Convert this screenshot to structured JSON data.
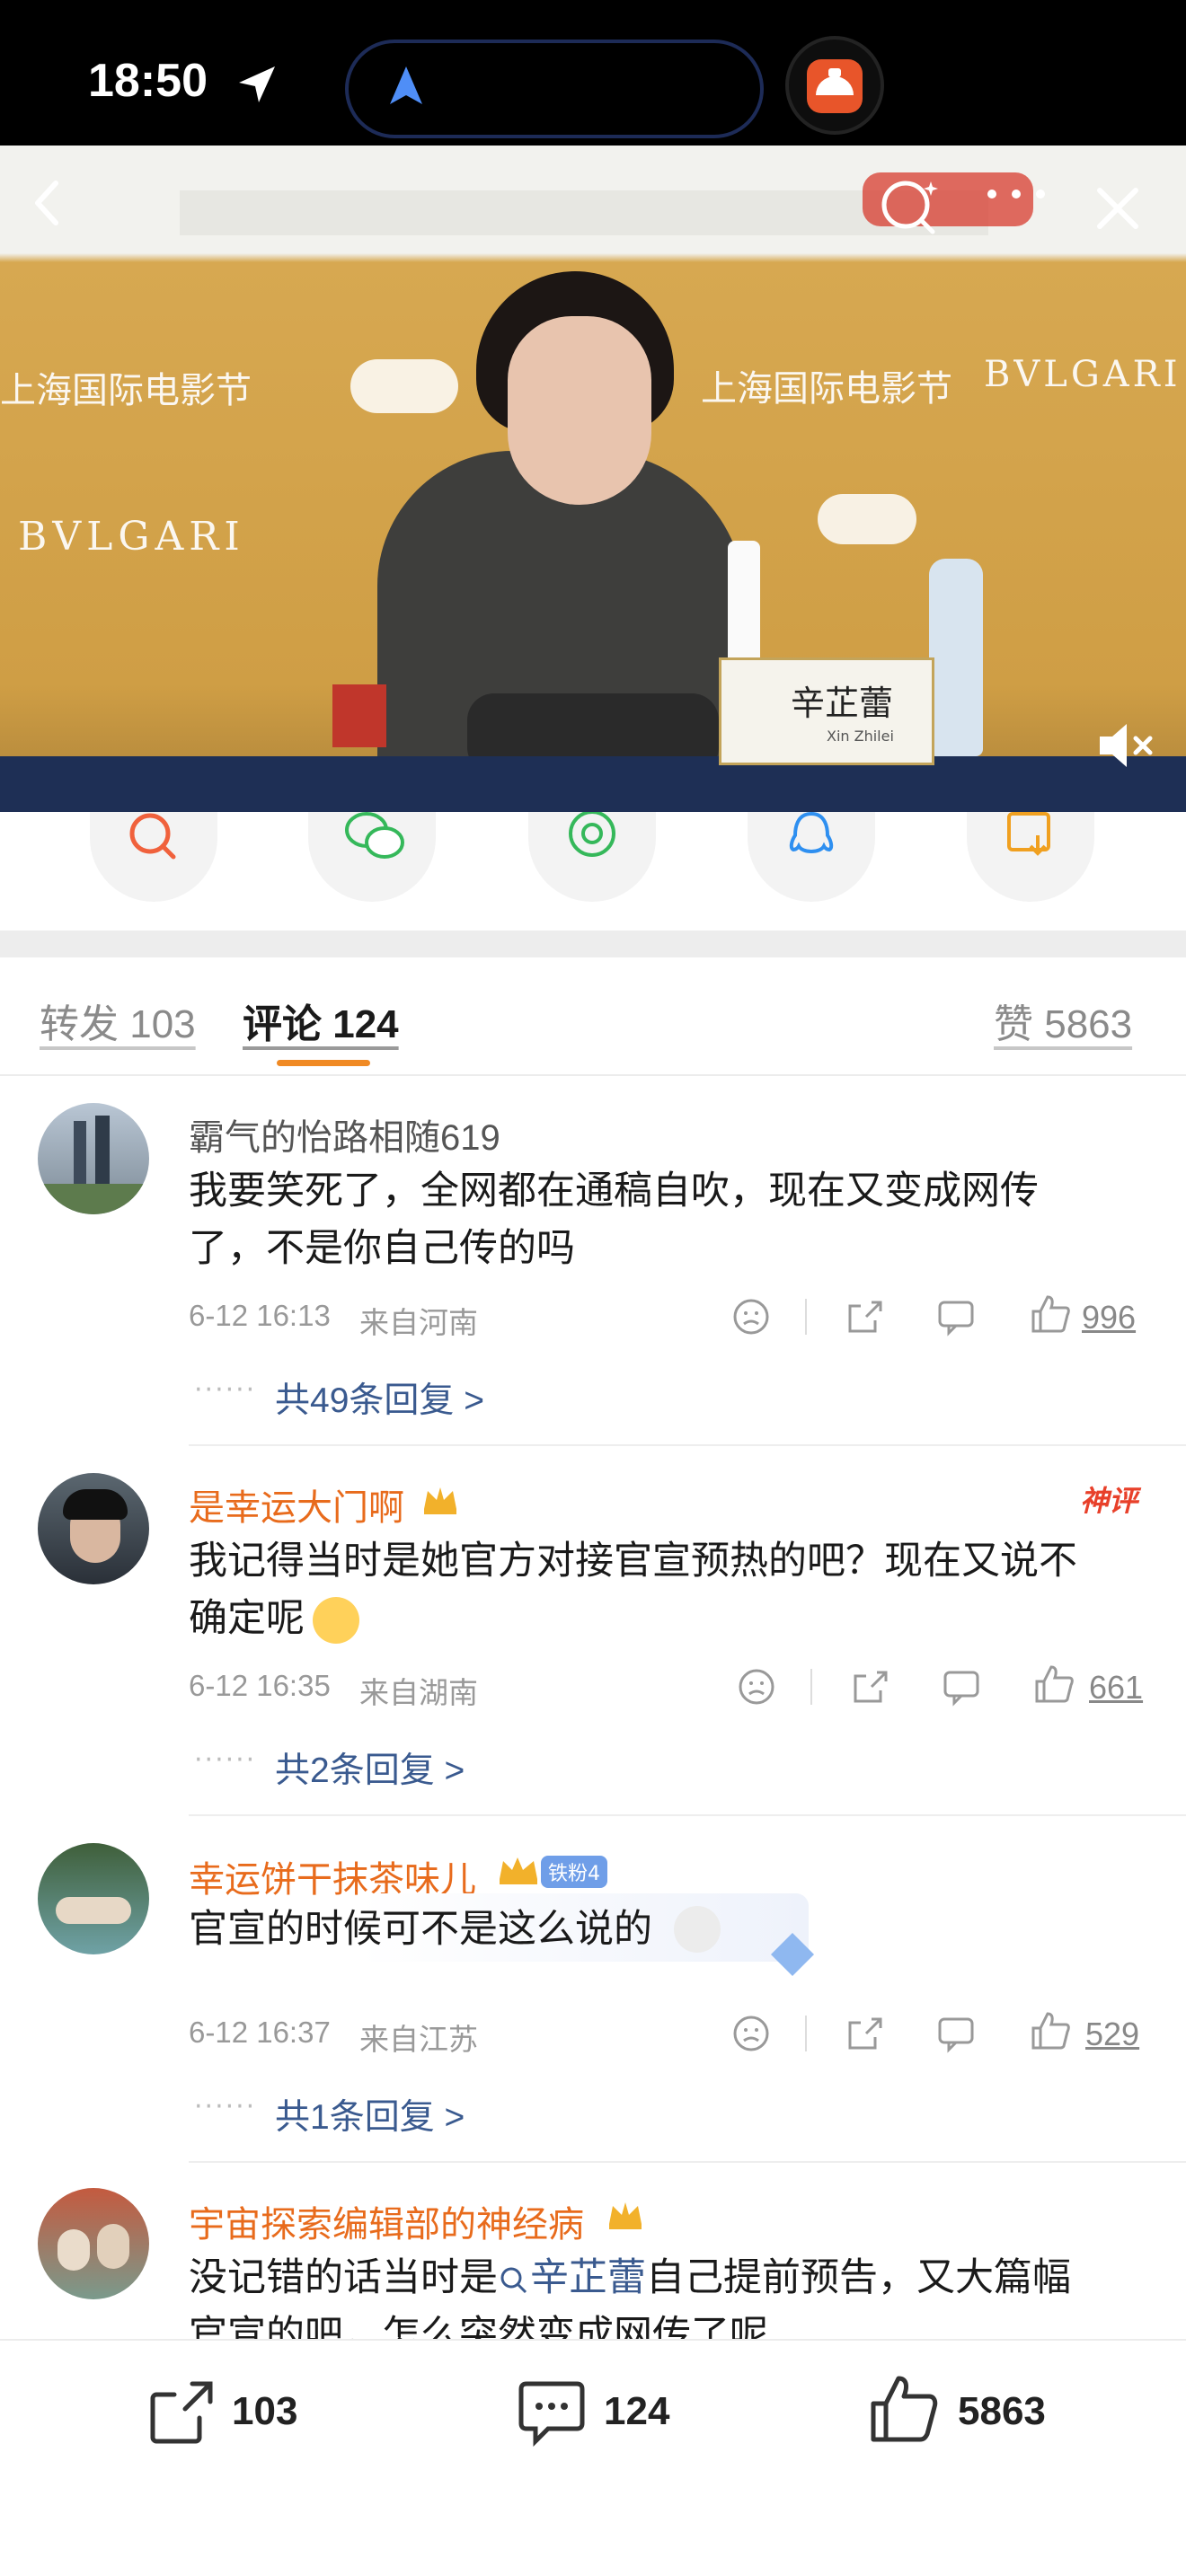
{
  "status_bar": {
    "time": "18:50"
  },
  "video": {
    "banner_texts": [
      "上海国际电影节",
      "BVLGARI",
      "上海国际电影节",
      "BVLGARI",
      "BVLGARI"
    ],
    "nameplate_cn": "辛芷蕾",
    "nameplate_en": "Xin Zhilei"
  },
  "share_icons": [
    "search-share-icon",
    "wechat-icon",
    "moments-icon",
    "qq-icon",
    "save-image-icon"
  ],
  "tabs": {
    "reposts": "转发 103",
    "comments": "评论 124",
    "likes": "赞 5863"
  },
  "comments": [
    {
      "name": "霸气的怡路相随619",
      "text": "我要笑死了，全网都在通稿自吹，现在又变成网传了，不是你自己传的吗",
      "date": "6-12 16:13",
      "location": "来自河南",
      "likes": "996",
      "replies": "共49条回复 >"
    },
    {
      "name": "是幸运大门啊",
      "text": "我记得当时是她官方对接官宣预热的吧？现在又说不确定呢",
      "badge": "神评",
      "date": "6-12 16:35",
      "location": "来自湖南",
      "likes": "661",
      "replies": "共2条回复 >"
    },
    {
      "name": "幸运饼干抹茶味儿",
      "fan_badge": "铁粉4",
      "text": "官宣的时候可不是这么说的",
      "date": "6-12 16:37",
      "location": "来自江苏",
      "likes": "529",
      "replies": "共1条回复 >"
    },
    {
      "name": "宇宙探索编辑部的神经病",
      "text_prefix": "没记错的话当时是",
      "text_link": "辛芷蕾",
      "text_suffix": "自己提前预告，又大篇幅",
      "text_line2": "官宣的吧，怎么突然变成网传了呢"
    }
  ],
  "bottom_bar": {
    "reposts": "103",
    "comments": "124",
    "likes": "5863"
  },
  "colors": {
    "accent_orange": "#f08a24",
    "name_orange": "#e86b1c",
    "link_blue": "#3a5a8f"
  }
}
